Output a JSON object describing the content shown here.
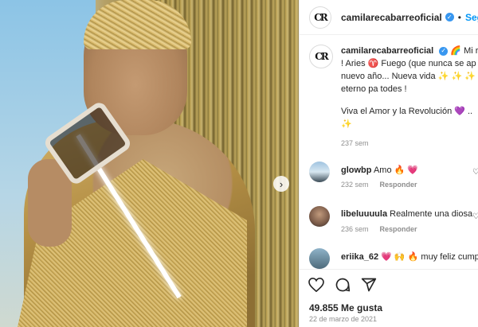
{
  "post": {
    "username": "camilarecabarreoficial",
    "follow_label": "Segu",
    "separator": "•",
    "caption": {
      "line1": "camilarecabarreoficial ✓ 🌈 Mi r",
      "line2": "! Aries ♈ Fuego (que nunca se ap",
      "line3": "nuevo año... Nueva vida ✨ ✨ ✨",
      "line4": "eterno pa todes !",
      "line5": "Viva el Amor y la Revolución 💜 ..",
      "line6": "✨",
      "time": "237 sem"
    },
    "caption_user": "camilarecabarreoficial",
    "caption_rest": " Mi r",
    "caption_emoji": "🌈",
    "caption_lines": [
      "! Aries ♈ Fuego (que nunca se ap",
      "nuevo año... Nueva vida ✨ ✨ ✨",
      "eterno pa todes !"
    ],
    "caption_line_viva": "Viva el Amor y la Revolución 💜 ..",
    "caption_line_sparkle": "✨",
    "caption_time": "237 sem"
  },
  "comments": [
    {
      "user": "glowbp",
      "text": " Amo 🔥 💗",
      "time": "232 sem",
      "reply": "Responder"
    },
    {
      "user": "libeluuuula",
      "text": " Realmente una diosa",
      "time": "236 sem",
      "reply": "Responder"
    },
    {
      "user": "eriika_62",
      "text": " 💗 🙌 🔥 muy feliz cump",
      "time": "",
      "reply": ""
    }
  ],
  "footer": {
    "likes": "49.855 Me gusta",
    "date": "22 de marzo de 2021"
  },
  "icons": {
    "like": "heart-icon",
    "comment": "comment-icon",
    "share": "share-icon",
    "next": "chevron-right-icon"
  },
  "colors": {
    "accent": "#0095f6",
    "verified": "#3897f0",
    "muted": "#8e8e8e"
  }
}
